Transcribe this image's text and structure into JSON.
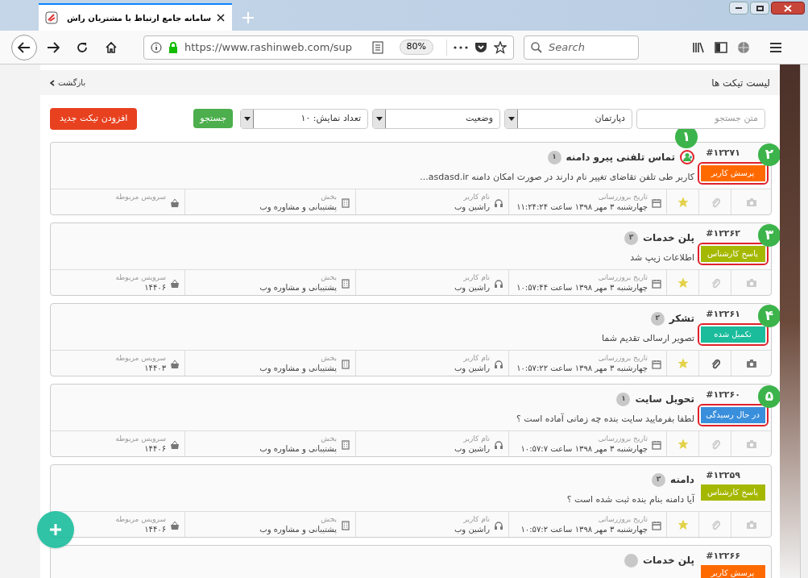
{
  "browser": {
    "tab_title": "سامانه جامع ارتباط با مشتریان راش",
    "url": "https://www.rashinweb.com/sup",
    "zoom": "80%",
    "search_placeholder": "Search"
  },
  "page": {
    "title": "لیست تیکت ها",
    "back": "بازگشت"
  },
  "filters": {
    "search_placeholder": "متن جستجو",
    "department": "دپارتمان",
    "status": "وضعیت",
    "page_size": "تعداد نمایش: ۱۰",
    "search_button": "جستجو",
    "new_button": "افزودن تیکت جدید"
  },
  "tickets": [
    {
      "id": "#۱۲۲۷۱",
      "title": "تماس تلفنی پیرو دامنه",
      "count": "۱",
      "title_icon": {
        "callout": "۱"
      },
      "status": {
        "label": "پرسش کاربر",
        "color": "#ff6a00"
      },
      "callout": "۲",
      "description": "کاربر طی تلفن تقاضای تغییر نام دارند در صورت امکان دامنه asdasd.ir...",
      "has_image": false,
      "has_attachment": false,
      "meta": [
        {
          "kind": "date",
          "label": "تاریخ بروزرسانی",
          "value": "چهارشنبه ۳ مهر ۱۳۹۸ ساعت ۱۱:۲۴:۲۴"
        },
        {
          "kind": "user",
          "label": "نام کاربر",
          "value": "راشین وب"
        },
        {
          "kind": "department",
          "label": "بخش",
          "value": "پشتیبانی و مشاوره وب"
        },
        {
          "kind": "service",
          "label": "سرویس مربوطه"
        }
      ]
    },
    {
      "id": "#۱۲۲۶۲",
      "title": "پلن خدمات",
      "count": "۳",
      "status": {
        "label": "پاسخ کارشناس",
        "color": "#a5b800"
      },
      "callout": "۳",
      "description": "اطلاعات زیپ شد",
      "has_image": false,
      "has_attachment": false,
      "meta": [
        {
          "kind": "date",
          "label": "تاریخ بروزرسانی",
          "value": "چهارشنبه ۳ مهر ۱۳۹۸ ساعت ۱۰:۵۷:۴۴"
        },
        {
          "kind": "user",
          "label": "نام کاربر",
          "value": "راشین وب"
        },
        {
          "kind": "department",
          "label": "بخش",
          "value": "پشتیبانی و مشاوره وب"
        },
        {
          "kind": "service",
          "label": "سرویس مربوطه",
          "value": "۱۴۴۰۶"
        }
      ]
    },
    {
      "id": "#۱۲۲۶۱",
      "title": "تشکر",
      "count": "۲",
      "status": {
        "label": "تکمیل شده",
        "color": "#1abc9c"
      },
      "callout": "۴",
      "description": "تصویر ارسالی تقدیم شما",
      "has_image": true,
      "has_attachment": true,
      "meta": [
        {
          "kind": "date",
          "label": "تاریخ بروزرسانی",
          "value": "چهارشنبه ۳ مهر ۱۳۹۸ ساعت ۱۰:۵۷:۲۲"
        },
        {
          "kind": "user",
          "label": "نام کاربر",
          "value": "راشین وب"
        },
        {
          "kind": "department",
          "label": "بخش",
          "value": "پشتیبانی و مشاوره وب"
        },
        {
          "kind": "service",
          "label": "سرویس مربوطه",
          "value": "۱۴۴۰۳"
        }
      ]
    },
    {
      "id": "#۱۲۲۶۰",
      "title": "تحویل سایت",
      "count": "۱",
      "status": {
        "label": "در حال رسیدگی",
        "color": "#3a8fdc"
      },
      "callout": "۵",
      "description": "لطفا بفرمایید سایت بنده چه زمانی آماده است ؟",
      "has_image": false,
      "has_attachment": false,
      "meta": [
        {
          "kind": "date",
          "label": "تاریخ بروزرسانی",
          "value": "چهارشنبه ۳ مهر ۱۳۹۸ ساعت ۱۰:۵۷:۷"
        },
        {
          "kind": "user",
          "label": "نام کاربر",
          "value": "راشین وب"
        },
        {
          "kind": "department",
          "label": "بخش",
          "value": "پشتیبانی و مشاوره وب"
        },
        {
          "kind": "service",
          "label": "سرویس مربوطه",
          "value": "۱۴۴۰۶"
        }
      ]
    },
    {
      "id": "#۱۲۲۵۹",
      "title": "دامنه",
      "count": "۲",
      "status": {
        "label": "پاسخ کارشناس",
        "color": "#a5b800"
      },
      "description": "آیا دامنه بنام بنده ثبت شده است ؟",
      "has_image": false,
      "has_attachment": false,
      "meta": [
        {
          "kind": "date",
          "label": "تاریخ بروزرسانی",
          "value": "چهارشنبه ۳ مهر ۱۳۹۸ ساعت ۱۰:۵۷:۲"
        },
        {
          "kind": "user",
          "label": "نام کاربر",
          "value": "راشین وب"
        },
        {
          "kind": "department",
          "label": "بخش",
          "value": "پشتیبانی و مشاوره وب"
        },
        {
          "kind": "service",
          "label": "سرویس مربوطه",
          "value": "۱۴۴۰۶"
        }
      ]
    },
    {
      "id": "#۱۲۲۶۶",
      "title": "پلن خدمات",
      "status": {
        "label": "پرسش کاربر",
        "color": "#ff6a00"
      }
    }
  ]
}
